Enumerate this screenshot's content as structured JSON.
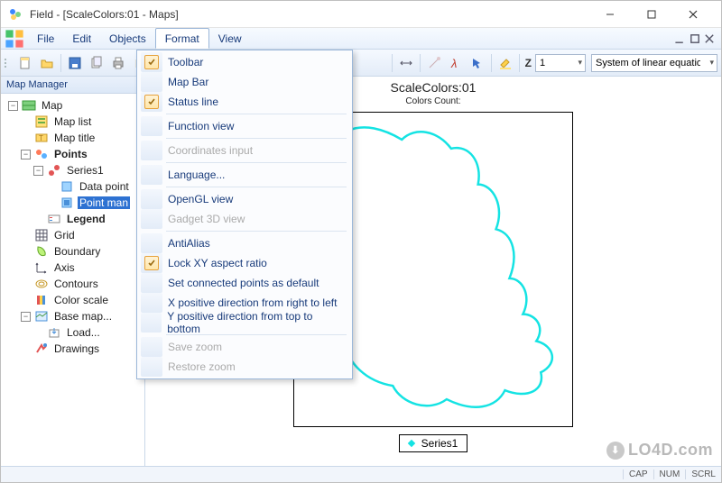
{
  "window": {
    "title": "Field - [ScaleColors:01 - Maps]"
  },
  "menubar": {
    "items": [
      "File",
      "Edit",
      "Objects",
      "Format",
      "View"
    ],
    "active_index": 3
  },
  "toolbar": {
    "z_label": "Z",
    "z_value": "1",
    "system_label": "System of linear equatio"
  },
  "sidebar": {
    "title": "Map Manager",
    "tree": [
      {
        "level": 0,
        "exp": "-",
        "icon": "map",
        "label": "Map"
      },
      {
        "level": 1,
        "exp": " ",
        "icon": "maplist",
        "label": "Map list"
      },
      {
        "level": 1,
        "exp": " ",
        "icon": "maptitle",
        "label": "Map title"
      },
      {
        "level": 1,
        "exp": "-",
        "icon": "points",
        "label": "Points"
      },
      {
        "level": 2,
        "exp": "-",
        "icon": "series",
        "label": "Series1"
      },
      {
        "level": 3,
        "exp": " ",
        "icon": "datapoint",
        "label": "Data point"
      },
      {
        "level": 3,
        "exp": " ",
        "icon": "pointmgr",
        "label": "Point man",
        "selected": true
      },
      {
        "level": 2,
        "exp": " ",
        "icon": "legend",
        "label": "Legend"
      },
      {
        "level": 1,
        "exp": " ",
        "icon": "grid",
        "label": "Grid"
      },
      {
        "level": 1,
        "exp": " ",
        "icon": "boundary",
        "label": "Boundary"
      },
      {
        "level": 1,
        "exp": " ",
        "icon": "axis",
        "label": "Axis"
      },
      {
        "level": 1,
        "exp": " ",
        "icon": "contours",
        "label": "Contours"
      },
      {
        "level": 1,
        "exp": " ",
        "icon": "colorscale",
        "label": "Color scale"
      },
      {
        "level": 1,
        "exp": "-",
        "icon": "basemap",
        "label": "Base map..."
      },
      {
        "level": 2,
        "exp": " ",
        "icon": "load",
        "label": "Load..."
      },
      {
        "level": 1,
        "exp": " ",
        "icon": "drawings",
        "label": "Drawings"
      }
    ]
  },
  "format_menu": {
    "items": [
      {
        "label": "Toolbar",
        "checked": true
      },
      {
        "label": "Map Bar"
      },
      {
        "label": "Status line",
        "checked": true
      },
      {
        "sep": true
      },
      {
        "label": "Function view"
      },
      {
        "sep": true
      },
      {
        "label": "Coordinates input",
        "disabled": true
      },
      {
        "sep": true
      },
      {
        "label": "Language..."
      },
      {
        "sep": true
      },
      {
        "label": "OpenGL view"
      },
      {
        "label": "Gadget 3D view",
        "disabled": true
      },
      {
        "sep": true
      },
      {
        "label": "AntiAlias"
      },
      {
        "label": "Lock XY aspect ratio",
        "checked": true
      },
      {
        "label": "Set connected points as default"
      },
      {
        "label": "X positive direction from right to left"
      },
      {
        "label": "Y positive direction from top to bottom"
      },
      {
        "sep": true
      },
      {
        "label": "Save zoom",
        "disabled": true
      },
      {
        "label": "Restore zoom",
        "disabled": true
      }
    ]
  },
  "canvas": {
    "title": "ScaleColors:01",
    "subtitle": "Colors Count:",
    "legend_label": "Series1"
  },
  "statusbar": {
    "cap": "CAP",
    "num": "NUM",
    "scrl": "SCRL"
  },
  "watermark": "LO4D.com"
}
